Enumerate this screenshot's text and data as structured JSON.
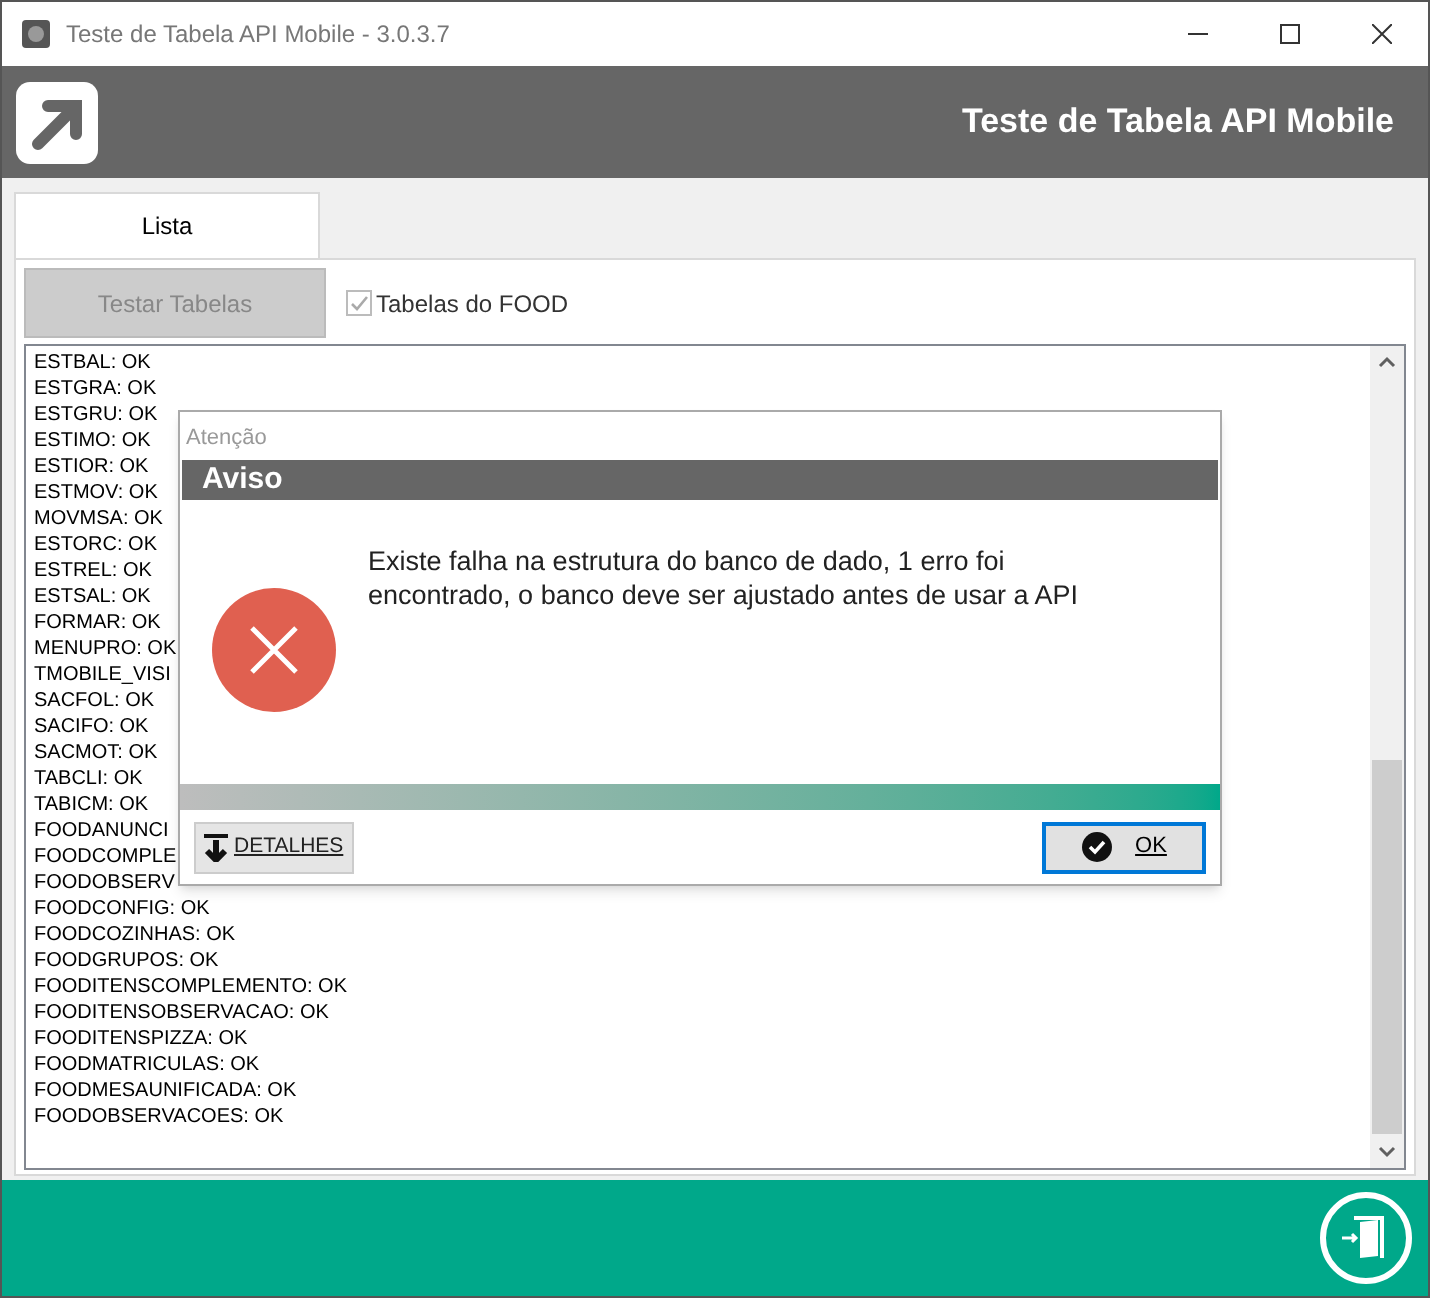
{
  "window": {
    "title": "Teste de Tabela API Mobile - 3.0.3.7"
  },
  "header": {
    "title": "Teste de Tabela API Mobile"
  },
  "tabs": [
    {
      "label": "Lista",
      "selected": true
    }
  ],
  "test_button": {
    "label": "Testar Tabelas",
    "disabled": true
  },
  "food_checkbox": {
    "label": "Tabelas do FOOD",
    "checked": true,
    "disabled": true
  },
  "results": [
    "ESTBAL: OK",
    "ESTGRA: OK",
    "ESTGRU: OK",
    "ESTIMO: OK",
    "ESTIOR: OK",
    "ESTMOV: OK",
    "MOVMSA: OK",
    "ESTORC: OK",
    "ESTREL: OK",
    "ESTSAL: OK",
    "FORMAR: OK",
    "MENUPRO: OK",
    "TMOBILE_VISI",
    "SACFOL: OK",
    "SACIFO: OK",
    "SACMOT: OK",
    "TABCLI: OK",
    "TABICM: OK",
    "FOODANUNCI",
    "FOODCOMPLE",
    "FOODOBSERV",
    "FOODCONFIG: OK",
    "FOODCOZINHAS: OK",
    "FOODGRUPOS: OK",
    "FOODITENSCOMPLEMENTO: OK",
    "FOODITENSOBSERVACAO: OK",
    "FOODITENSPIZZA: OK",
    "FOODMATRICULAS: OK",
    "FOODMESAUNIFICADA: OK",
    "FOODOBSERVACOES: OK"
  ],
  "dialog": {
    "title": "Atenção",
    "heading": "Aviso",
    "message": "Existe falha na estrutura do banco de dado, 1 erro foi encontrado, o banco deve ser ajustado antes de usar a API",
    "details_button": "DETALHES",
    "ok_button": "OK"
  }
}
